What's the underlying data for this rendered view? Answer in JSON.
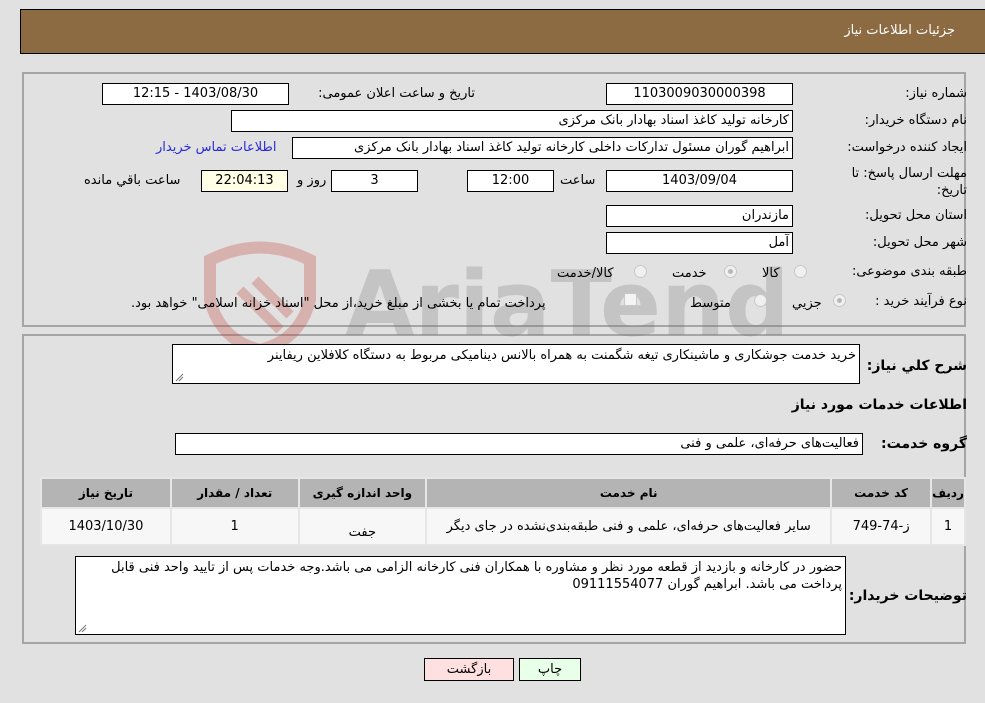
{
  "header": {
    "title": "جزئیات اطلاعات نیاز"
  },
  "form": {
    "need_number": {
      "label": "شماره نیاز:",
      "value": "1103009030000398"
    },
    "announce_datetime": {
      "label": "تاریخ و ساعت اعلان عمومی:",
      "value": "1403/08/30 - 12:15"
    },
    "buyer_org": {
      "label": "نام دستگاه خریدار:",
      "value": "کارخانه تولید کاغذ اسناد بهادار بانک مرکزی"
    },
    "requester": {
      "label": "ایجاد کننده درخواست:",
      "value": "ابراهیم گوران مسئول تدارکات داخلی کارخانه تولید کاغذ اسناد بهادار بانک مرکزی",
      "contact_link": "اطلاعات تماس خریدار"
    },
    "deadline": {
      "label": "مهلت ارسال پاسخ: تا تاریخ:",
      "date": "1403/09/04",
      "time_label": "ساعت",
      "time": "12:00",
      "days": "3",
      "days_label": "روز و",
      "remaining": "22:04:13",
      "remaining_label": "ساعت باقي مانده"
    },
    "province": {
      "label": "استان محل تحویل:",
      "value": "مازندران"
    },
    "city": {
      "label": "شهر محل تحویل:",
      "value": "آمل"
    },
    "category": {
      "label": "طبقه بندی موضوعی:",
      "options": [
        "کالا",
        "خدمت",
        "کالا/خدمت"
      ],
      "selected": "خدمت"
    },
    "purchase_type": {
      "label": "نوع فرآیند خرید :",
      "options": [
        "جزيي",
        "متوسط"
      ],
      "selected": "جزيي",
      "payment_note": "پرداخت تمام یا بخشی از مبلغ خرید،از محل \"اسناد خزانه اسلامی\" خواهد بود."
    }
  },
  "description": {
    "label": "شرح کلي نياز:",
    "value": "خرید خدمت جوشکاری و ماشینکاری تیغه شگمنت به همراه بالانس دینامیکی مربوط به دستگاه کلافلاین ریفاینر"
  },
  "services_section": {
    "title": "اطلاعات خدمات مورد نیاز"
  },
  "service_group": {
    "label": "گروه خدمت:",
    "value": "فعالیت‌های حرفه‌ای، علمی و فنی"
  },
  "table": {
    "headers": [
      "ردیف",
      "کد خدمت",
      "نام خدمت",
      "واحد اندازه گیری",
      "تعداد / مقدار",
      "تاریخ نیاز"
    ],
    "rows": [
      [
        "1",
        "ز-74-749",
        "سایر فعالیت‌های حرفه‌ای، علمی و فنی طبقه‌بندی‌نشده در جای دیگر",
        "جفت",
        "1",
        "1403/10/30"
      ]
    ]
  },
  "buyer_notes": {
    "label": "توضیحات خریدار:",
    "value": "حضور در کارخانه و بازدید از قطعه مورد نظر و مشاوره با همکاران فنی کارخانه الزامی می باشد.وجه خدمات پس از تایید واحد فنی قابل پرداخت می باشد. ابراهیم گوران 09111554077"
  },
  "buttons": {
    "back": "بازگشت",
    "print": "چاپ"
  },
  "colors": {
    "header_bg": "#8c6b42",
    "link": "#2a2ad4",
    "back_btn": "#ffe0e0",
    "print_btn": "#e8ffe8"
  }
}
